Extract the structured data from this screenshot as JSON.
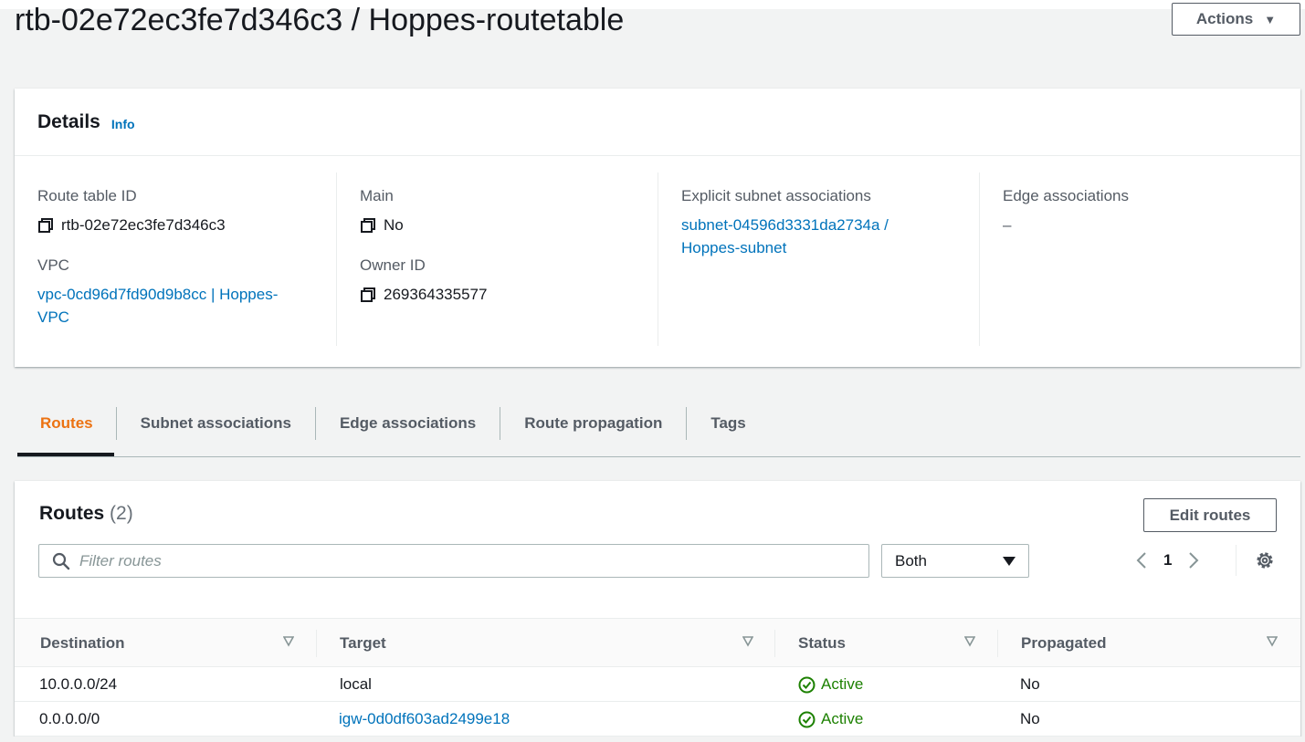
{
  "header": {
    "title": "rtb-02e72ec3fe7d346c3 / Hoppes-routetable",
    "actions_label": "Actions"
  },
  "details": {
    "title": "Details",
    "info_label": "Info",
    "route_table_id_label": "Route table ID",
    "route_table_id": "rtb-02e72ec3fe7d346c3",
    "vpc_label": "VPC",
    "vpc_value": "vpc-0cd96d7fd90d9b8cc | Hoppes-VPC",
    "vpc_line1": "vpc-0cd96d7fd90d9b8cc | Hoppes-",
    "vpc_line2": "VPC",
    "main_label": "Main",
    "main_value": "No",
    "owner_label": "Owner ID",
    "owner_value": "269364335577",
    "explicit_label": "Explicit subnet associations",
    "explicit_line1": "subnet-04596d3331da2734a /",
    "explicit_line2": "Hoppes-subnet",
    "edge_label": "Edge associations",
    "edge_value": "–"
  },
  "tabs": [
    {
      "label": "Routes",
      "active": true
    },
    {
      "label": "Subnet associations",
      "active": false
    },
    {
      "label": "Edge associations",
      "active": false
    },
    {
      "label": "Route propagation",
      "active": false
    },
    {
      "label": "Tags",
      "active": false
    }
  ],
  "routes": {
    "title": "Routes",
    "count": "(2)",
    "edit_label": "Edit routes",
    "filter_placeholder": "Filter routes",
    "select_value": "Both",
    "page": "1",
    "columns": [
      "Destination",
      "Target",
      "Status",
      "Propagated"
    ],
    "rows": [
      {
        "destination": "10.0.0.0/24",
        "target": "local",
        "target_link": false,
        "status": "Active",
        "propagated": "No"
      },
      {
        "destination": "0.0.0.0/0",
        "target": "igw-0d0df603ad2499e18",
        "target_link": true,
        "status": "Active",
        "propagated": "No"
      }
    ]
  },
  "colors": {
    "link": "#0073bb",
    "active_tab": "#ec7211",
    "success": "#1d8102",
    "background": "#f2f3f3"
  },
  "icons": [
    "copy-icon",
    "search-icon",
    "caret-down-icon",
    "chevron-left-icon",
    "chevron-right-icon",
    "gear-icon",
    "sort-icon",
    "status-success-icon"
  ]
}
